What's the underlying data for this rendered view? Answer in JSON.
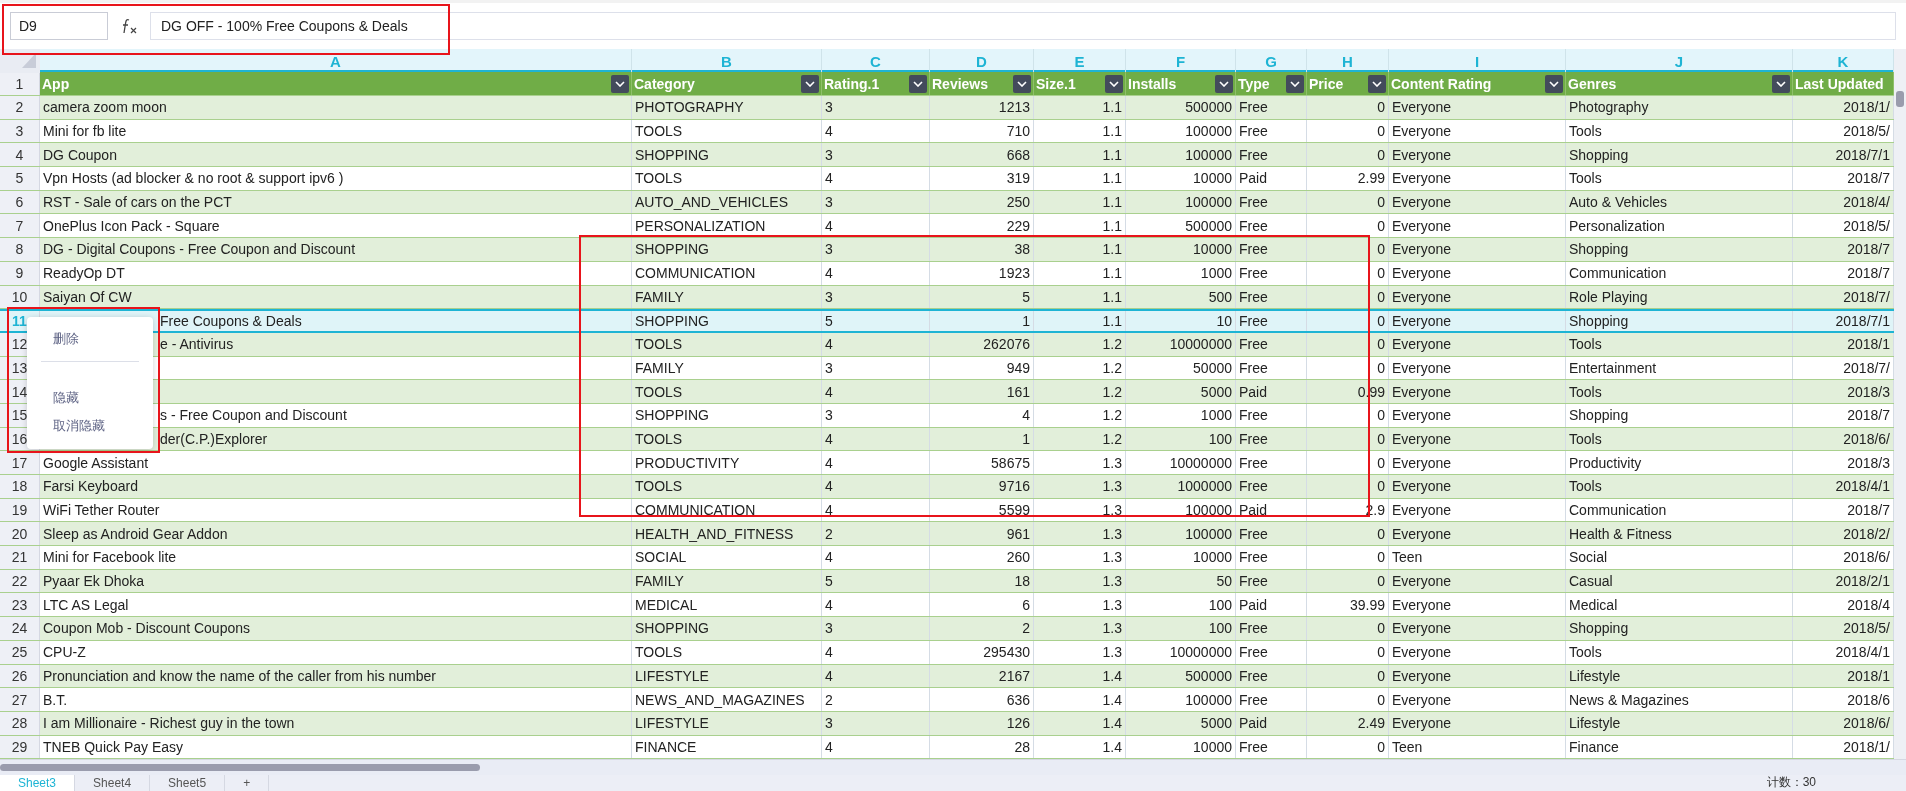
{
  "formula_bar": {
    "cell_ref": "D9",
    "formula": "DG OFF - 100% Free Coupons & Deals"
  },
  "columns": [
    {
      "letter": "A",
      "heading": "App",
      "filter": true
    },
    {
      "letter": "B",
      "heading": "Category",
      "filter": true
    },
    {
      "letter": "C",
      "heading": "Rating.1",
      "filter": true
    },
    {
      "letter": "D",
      "heading": "Reviews",
      "filter": true
    },
    {
      "letter": "E",
      "heading": "Size.1",
      "filter": true
    },
    {
      "letter": "F",
      "heading": "Installs",
      "filter": true
    },
    {
      "letter": "G",
      "heading": "Type",
      "filter": true
    },
    {
      "letter": "H",
      "heading": "Price",
      "filter": true
    },
    {
      "letter": "I",
      "heading": "Content Rating",
      "filter": true
    },
    {
      "letter": "J",
      "heading": "Genres",
      "filter": true
    },
    {
      "letter": "K",
      "heading": "Last Updated",
      "filter": false
    }
  ],
  "header_row_number": "1",
  "rows": [
    {
      "num": "2",
      "selected": false,
      "partly_hidden": false,
      "cells": [
        "camera zoom moon",
        "PHOTOGRAPHY",
        "3",
        "1213",
        "1.1",
        "500000",
        "Free",
        "0",
        "Everyone",
        "Photography",
        "2018/1/"
      ]
    },
    {
      "num": "3",
      "selected": false,
      "partly_hidden": false,
      "cells": [
        "Mini for fb lite",
        "TOOLS",
        "4",
        "710",
        "1.1",
        "100000",
        "Free",
        "0",
        "Everyone",
        "Tools",
        "2018/5/"
      ]
    },
    {
      "num": "4",
      "selected": false,
      "partly_hidden": false,
      "cells": [
        "DG Coupon",
        "SHOPPING",
        "3",
        "668",
        "1.1",
        "100000",
        "Free",
        "0",
        "Everyone",
        "Shopping",
        "2018/7/1"
      ]
    },
    {
      "num": "5",
      "selected": false,
      "partly_hidden": false,
      "cells": [
        "Vpn Hosts (ad blocker & no root & support ipv6 )",
        "TOOLS",
        "4",
        "319",
        "1.1",
        "10000",
        "Paid",
        "2.99",
        "Everyone",
        "Tools",
        "2018/7"
      ]
    },
    {
      "num": "6",
      "selected": false,
      "partly_hidden": false,
      "cells": [
        "RST - Sale of cars on the PCT",
        "AUTO_AND_VEHICLES",
        "3",
        "250",
        "1.1",
        "100000",
        "Free",
        "0",
        "Everyone",
        "Auto & Vehicles",
        "2018/4/"
      ]
    },
    {
      "num": "7",
      "selected": false,
      "partly_hidden": false,
      "cells": [
        "OnePlus Icon Pack - Square",
        "PERSONALIZATION",
        "4",
        "229",
        "1.1",
        "500000",
        "Free",
        "0",
        "Everyone",
        "Personalization",
        "2018/5/"
      ]
    },
    {
      "num": "8",
      "selected": false,
      "partly_hidden": false,
      "cells": [
        "DG - Digital Coupons - Free Coupon and Discount",
        "SHOPPING",
        "3",
        "38",
        "1.1",
        "10000",
        "Free",
        "0",
        "Everyone",
        "Shopping",
        "2018/7"
      ]
    },
    {
      "num": "9",
      "selected": false,
      "partly_hidden": false,
      "cells": [
        "ReadyOp DT",
        "COMMUNICATION",
        "4",
        "1923",
        "1.1",
        "1000",
        "Free",
        "0",
        "Everyone",
        "Communication",
        "2018/7"
      ]
    },
    {
      "num": "10",
      "selected": false,
      "partly_hidden": false,
      "cells": [
        "Saiyan Of CW",
        "FAMILY",
        "3",
        "5",
        "1.1",
        "500",
        "Free",
        "0",
        "Everyone",
        "Role Playing",
        "2018/7/"
      ]
    },
    {
      "num": "11",
      "selected": true,
      "partly_hidden": true,
      "cells": [
        "Free Coupons & Deals",
        "SHOPPING",
        "5",
        "1",
        "1.1",
        "10",
        "Free",
        "0",
        "Everyone",
        "Shopping",
        "2018/7/1"
      ]
    },
    {
      "num": "12",
      "selected": false,
      "partly_hidden": true,
      "cells": [
        "e - Antivirus",
        "TOOLS",
        "4",
        "262076",
        "1.2",
        "10000000",
        "Free",
        "0",
        "Everyone",
        "Tools",
        "2018/1"
      ]
    },
    {
      "num": "13",
      "selected": false,
      "cells": [
        null,
        "FAMILY",
        "3",
        "949",
        "1.2",
        "50000",
        "Free",
        "0",
        "Everyone",
        "Entertainment",
        "2018/7/"
      ]
    },
    {
      "num": "14",
      "selected": false,
      "cells": [
        null,
        "TOOLS",
        "4",
        "161",
        "1.2",
        "5000",
        "Paid",
        "0.99",
        "Everyone",
        "Tools",
        "2018/3"
      ]
    },
    {
      "num": "15",
      "selected": false,
      "partly_hidden": true,
      "cells": [
        "s - Free Coupon and Discount",
        "SHOPPING",
        "3",
        "4",
        "1.2",
        "1000",
        "Free",
        "0",
        "Everyone",
        "Shopping",
        "2018/7"
      ]
    },
    {
      "num": "16",
      "selected": false,
      "partly_hidden": true,
      "cells": [
        "der(C.P.)Explorer",
        "TOOLS",
        "4",
        "1",
        "1.2",
        "100",
        "Free",
        "0",
        "Everyone",
        "Tools",
        "2018/6/"
      ]
    },
    {
      "num": "17",
      "selected": false,
      "partly_hidden": false,
      "cells": [
        "Google Assistant",
        "PRODUCTIVITY",
        "4",
        "58675",
        "1.3",
        "10000000",
        "Free",
        "0",
        "Everyone",
        "Productivity",
        "2018/3"
      ]
    },
    {
      "num": "18",
      "selected": false,
      "partly_hidden": false,
      "cells": [
        "Farsi Keyboard",
        "TOOLS",
        "4",
        "9716",
        "1.3",
        "1000000",
        "Free",
        "0",
        "Everyone",
        "Tools",
        "2018/4/1"
      ]
    },
    {
      "num": "19",
      "selected": false,
      "partly_hidden": false,
      "cells": [
        "WiFi Tether Router",
        "COMMUNICATION",
        "4",
        "5599",
        "1.3",
        "100000",
        "Paid",
        "2.9",
        "Everyone",
        "Communication",
        "2018/7"
      ]
    },
    {
      "num": "20",
      "selected": false,
      "partly_hidden": false,
      "cells": [
        "Sleep as Android Gear Addon",
        "HEALTH_AND_FITNESS",
        "2",
        "961",
        "1.3",
        "100000",
        "Free",
        "0",
        "Everyone",
        "Health & Fitness",
        "2018/2/"
      ]
    },
    {
      "num": "21",
      "selected": false,
      "partly_hidden": false,
      "cells": [
        "Mini for Facebook lite",
        "SOCIAL",
        "4",
        "260",
        "1.3",
        "10000",
        "Free",
        "0",
        "Teen",
        "Social",
        "2018/6/"
      ]
    },
    {
      "num": "22",
      "selected": false,
      "partly_hidden": false,
      "cells": [
        "Pyaar Ek Dhoka",
        "FAMILY",
        "5",
        "18",
        "1.3",
        "50",
        "Free",
        "0",
        "Everyone",
        "Casual",
        "2018/2/1"
      ]
    },
    {
      "num": "23",
      "selected": false,
      "partly_hidden": false,
      "cells": [
        "LTC AS Legal",
        "MEDICAL",
        "4",
        "6",
        "1.3",
        "100",
        "Paid",
        "39.99",
        "Everyone",
        "Medical",
        "2018/4"
      ]
    },
    {
      "num": "24",
      "selected": false,
      "partly_hidden": false,
      "cells": [
        "Coupon Mob - Discount Coupons",
        "SHOPPING",
        "3",
        "2",
        "1.3",
        "100",
        "Free",
        "0",
        "Everyone",
        "Shopping",
        "2018/5/"
      ]
    },
    {
      "num": "25",
      "selected": false,
      "partly_hidden": false,
      "cells": [
        "CPU-Z",
        "TOOLS",
        "4",
        "295430",
        "1.3",
        "10000000",
        "Free",
        "0",
        "Everyone",
        "Tools",
        "2018/4/1"
      ]
    },
    {
      "num": "26",
      "selected": false,
      "partly_hidden": false,
      "cells": [
        "Pronunciation and know the name of the caller from his number",
        "LIFESTYLE",
        "4",
        "2167",
        "1.4",
        "500000",
        "Free",
        "0",
        "Everyone",
        "Lifestyle",
        "2018/1"
      ]
    },
    {
      "num": "27",
      "selected": false,
      "partly_hidden": false,
      "cells": [
        "B.T.",
        "NEWS_AND_MAGAZINES",
        "2",
        "636",
        "1.4",
        "100000",
        "Free",
        "0",
        "Everyone",
        "News & Magazines",
        "2018/6"
      ]
    },
    {
      "num": "28",
      "selected": false,
      "partly_hidden": false,
      "cells": [
        "I am Millionaire - Richest guy in the town",
        "LIFESTYLE",
        "3",
        "126",
        "1.4",
        "5000",
        "Paid",
        "2.49",
        "Everyone",
        "Lifestyle",
        "2018/6/"
      ]
    },
    {
      "num": "29",
      "selected": false,
      "partly_hidden": false,
      "cells": [
        "TNEB Quick Pay Easy",
        "FINANCE",
        "4",
        "28",
        "1.4",
        "10000",
        "Free",
        "0",
        "Teen",
        "Finance",
        "2018/1/"
      ]
    }
  ],
  "context_menu": {
    "items": [
      {
        "kind": "item",
        "label": "删除"
      },
      {
        "kind": "divider"
      },
      {
        "kind": "item",
        "label": "隐藏"
      },
      {
        "kind": "item",
        "label": "取消隐藏"
      }
    ]
  },
  "sheet_tabs": [
    {
      "label": "Sheet3",
      "selected": true
    },
    {
      "label": "Sheet4",
      "selected": false
    },
    {
      "label": "Sheet5",
      "selected": false
    }
  ],
  "add_sheet": "+",
  "status_bar": {
    "count": "计数：30"
  }
}
